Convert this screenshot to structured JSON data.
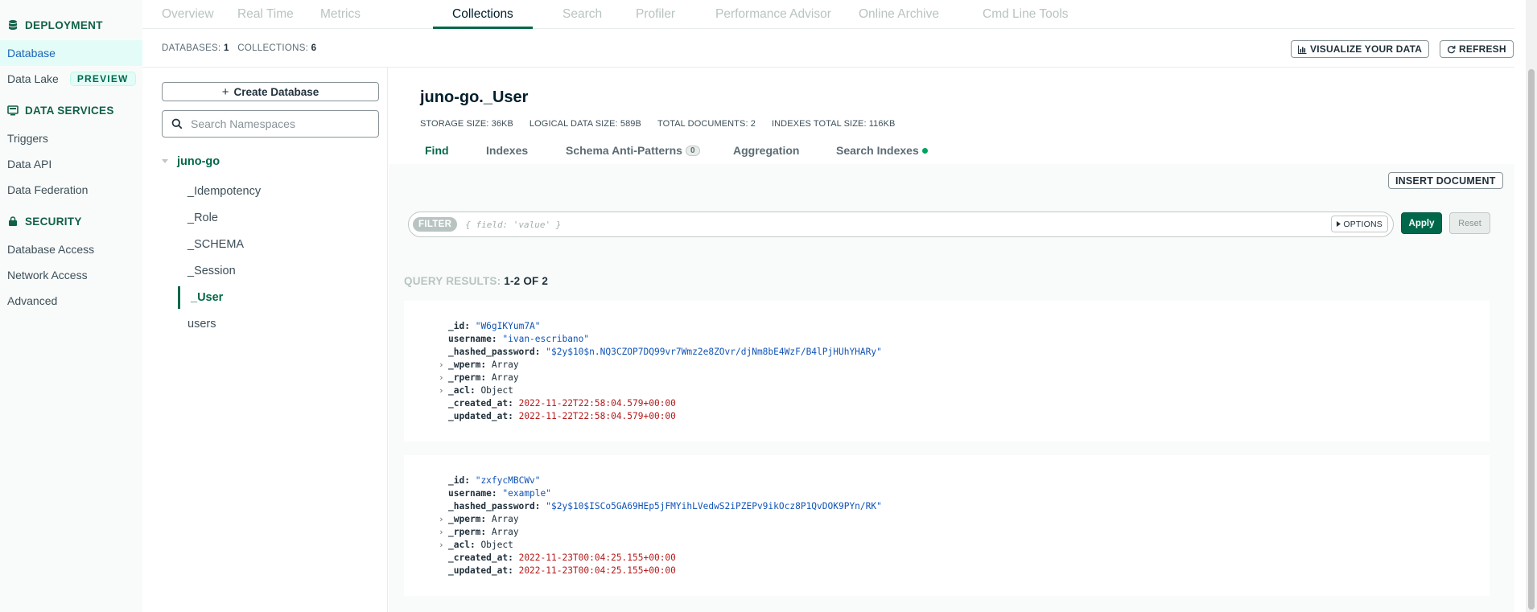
{
  "sidebar": {
    "deployment_heading": "DEPLOYMENT",
    "items_deployment": [
      {
        "label": "Database",
        "active": true
      },
      {
        "label": "Data Lake",
        "badge": "PREVIEW"
      }
    ],
    "data_services_heading": "DATA SERVICES",
    "items_data_services": [
      "Triggers",
      "Data API",
      "Data Federation"
    ],
    "security_heading": "SECURITY",
    "items_security": [
      "Database Access",
      "Network Access",
      "Advanced"
    ]
  },
  "top_tabs": [
    "Overview",
    "Real Time",
    "Metrics",
    "Collections",
    "Search",
    "Profiler",
    "Performance Advisor",
    "Online Archive",
    "Cmd Line Tools"
  ],
  "active_top_tab": "Collections",
  "stats": {
    "databases_label": "DATABASES:",
    "databases_value": "1",
    "collections_label": "COLLECTIONS:",
    "collections_value": "6",
    "visualize_label": "VISUALIZE YOUR DATA",
    "refresh_label": "REFRESH"
  },
  "namespaces": {
    "create_db_label": "Create Database",
    "search_placeholder": "Search Namespaces",
    "database": "juno-go",
    "collections": [
      "_Idempotency",
      "_Role",
      "_SCHEMA",
      "_Session",
      "_User",
      "users"
    ],
    "active_collection": "_User"
  },
  "collection": {
    "title": "juno-go._User",
    "storage_size": "STORAGE SIZE: 36KB",
    "logical_size": "LOGICAL DATA SIZE: 589B",
    "total_documents": "TOTAL DOCUMENTS: 2",
    "indexes_size": "INDEXES TOTAL SIZE: 116KB",
    "tabs": [
      "Find",
      "Indexes",
      "Schema Anti-Patterns",
      "Aggregation",
      "Search Indexes"
    ],
    "anti_patterns_count": "0"
  },
  "query": {
    "insert_label": "INSERT DOCUMENT",
    "filter_label": "FILTER",
    "filter_placeholder": "{ field: 'value' }",
    "options_label": "OPTIONS",
    "apply_label": "Apply",
    "reset_label": "Reset",
    "results_label": "QUERY RESULTS:",
    "results_range": "1-2 OF 2"
  },
  "documents": [
    {
      "_id": "\"W6gIKYum7A\"",
      "username": "\"ivan-escribano\"",
      "_hashed_password": "\"$2y$10$n.NQ3CZOP7DQ99vr7Wmz2e8ZOvr/djNm8bE4WzF/B4lPjHUhYHARy\"",
      "_wperm": "Array",
      "_rperm": "Array",
      "_acl": "Object",
      "_created_at": "2022-11-22T22:58:04.579+00:00",
      "_updated_at": "2022-11-22T22:58:04.579+00:00"
    },
    {
      "_id": "\"zxfycMBCWv\"",
      "username": "\"example\"",
      "_hashed_password": "\"$2y$10$ISCo5GA69HEp5jFMYihLVedwS2iPZEPv9ikOcz8P1QvDOK9PYn/RK\"",
      "_wperm": "Array",
      "_rperm": "Array",
      "_acl": "Object",
      "_created_at": "2022-11-23T00:04:25.155+00:00",
      "_updated_at": "2022-11-23T00:04:25.155+00:00"
    }
  ],
  "field_labels": {
    "_id": "_id:",
    "username": "username:",
    "_hashed_password": "_hashed_password:",
    "_wperm": "_wperm:",
    "_rperm": "_rperm:",
    "_acl": "_acl:",
    "_created_at": "_created_at:",
    "_updated_at": "_updated_at:"
  },
  "colors": {
    "brand_green": "#00684a",
    "string_blue": "#1254b7",
    "date_red": "#b51b1b"
  },
  "icons": [
    "database-icon",
    "data-services-icon",
    "lock-icon",
    "plus-icon",
    "search-icon",
    "chevron-down-icon",
    "bar-chart-icon",
    "refresh-icon",
    "caret-right-icon"
  ]
}
